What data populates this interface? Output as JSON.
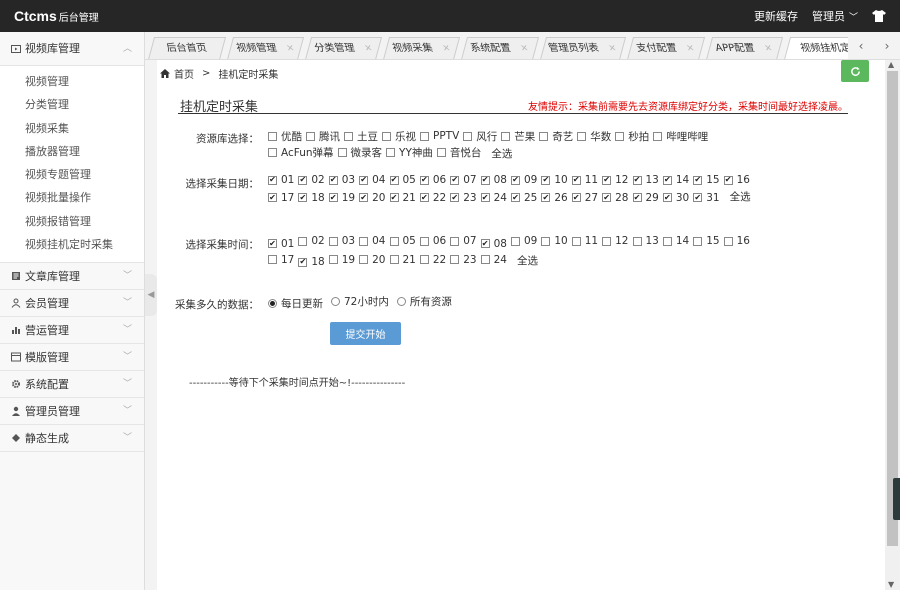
{
  "header": {
    "logo": "Ctcms",
    "logo_sub": "后台管理",
    "update_cache": "更新缓存",
    "admin": "管理员",
    "shirt_icon": "tshirt-icon"
  },
  "sidebar": {
    "groups": [
      {
        "label": "视频库管理",
        "icon": "video-library-icon",
        "open": true,
        "items": [
          "视频管理",
          "分类管理",
          "视频采集",
          "播放器管理",
          "视频专题管理",
          "视频批量操作",
          "视频报错管理",
          "视频挂机定时采集"
        ]
      },
      {
        "label": "文章库管理",
        "icon": "article-icon"
      },
      {
        "label": "会员管理",
        "icon": "user-icon"
      },
      {
        "label": "营运管理",
        "icon": "operation-icon"
      },
      {
        "label": "模版管理",
        "icon": "template-icon"
      },
      {
        "label": "系统配置",
        "icon": "gear-icon"
      },
      {
        "label": "管理员管理",
        "icon": "admin-icon"
      },
      {
        "label": "静态生成",
        "icon": "static-icon"
      }
    ]
  },
  "tabs": [
    {
      "label": "后台首页",
      "closable": false
    },
    {
      "label": "视频管理",
      "closable": true
    },
    {
      "label": "分类管理",
      "closable": true
    },
    {
      "label": "视频采集",
      "closable": true
    },
    {
      "label": "系统配置",
      "closable": true
    },
    {
      "label": "管理员列表",
      "closable": true
    },
    {
      "label": "支付配置",
      "closable": true
    },
    {
      "label": "APP配置",
      "closable": true
    },
    {
      "label": "视频挂机定",
      "closable": false,
      "active": true
    }
  ],
  "breadcrumb": {
    "home": "首页",
    "sep": ">",
    "current": "挂机定时采集"
  },
  "page": {
    "title": "挂机定时采集",
    "tip": "友情提示：采集前需要先去资源库绑定好分类，采集时间最好选择凌晨。",
    "source_label": "资源库选择：",
    "sources": [
      "优酷",
      "腾讯",
      "土豆",
      "乐视",
      "PPTV",
      "风行",
      "芒果",
      "奇艺",
      "华数",
      "秒拍",
      "哔哩哔哩",
      "AcFun弹幕",
      "微录客",
      "YY神曲",
      "音悦台"
    ],
    "select_all": "全选",
    "date_label": "选择采集日期：",
    "dates": [
      "01",
      "02",
      "03",
      "04",
      "05",
      "06",
      "07",
      "08",
      "09",
      "10",
      "11",
      "12",
      "13",
      "14",
      "15",
      "16",
      "17",
      "18",
      "19",
      "20",
      "21",
      "22",
      "23",
      "24",
      "25",
      "26",
      "27",
      "28",
      "29",
      "30",
      "31"
    ],
    "date_checked": [
      1,
      2,
      3,
      4,
      5,
      6,
      7,
      8,
      9,
      10,
      11,
      12,
      13,
      14,
      15,
      16,
      17,
      18,
      19,
      20,
      21,
      22,
      23,
      24,
      25,
      26,
      27,
      28,
      29,
      30,
      31
    ],
    "time_label": "选择采集时间：",
    "times": [
      "01",
      "02",
      "03",
      "04",
      "05",
      "06",
      "07",
      "08",
      "09",
      "10",
      "11",
      "12",
      "13",
      "14",
      "15",
      "16",
      "17",
      "18",
      "19",
      "20",
      "21",
      "22",
      "23",
      "24"
    ],
    "time_checked": [
      1,
      8,
      18
    ],
    "range_label": "采集多久的数据：",
    "ranges": [
      "每日更新",
      "72小时内",
      "所有资源"
    ],
    "range_selected": 0,
    "submit": "提交开始",
    "wait_msg": "-----------等待下个采集时间点开始~!---------------"
  }
}
